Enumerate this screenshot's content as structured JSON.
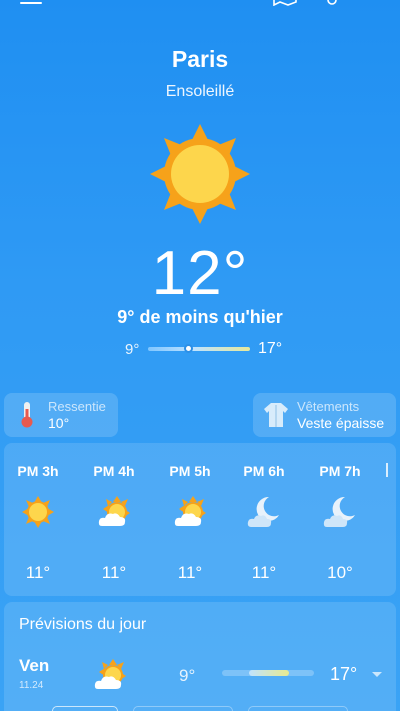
{
  "header": {
    "city": "Paris",
    "condition": "Ensoleillé",
    "temperature": "12°",
    "comparison": "9° de moins qu'hier",
    "range_low": "9°",
    "range_high": "17°",
    "range_position": 0.4
  },
  "chips": {
    "feels_like": {
      "label": "Ressentie",
      "value": "10°"
    },
    "clothing": {
      "label": "Vêtements",
      "value": "Veste épaisse"
    }
  },
  "hourly": [
    {
      "time": "PM 3h",
      "icon": "sun-icon",
      "temp": "11°"
    },
    {
      "time": "PM 4h",
      "icon": "sun-cloud-icon",
      "temp": "11°"
    },
    {
      "time": "PM 5h",
      "icon": "sun-cloud-icon",
      "temp": "11°"
    },
    {
      "time": "PM 6h",
      "icon": "moon-cloud-icon",
      "temp": "11°"
    },
    {
      "time": "PM 7h",
      "icon": "moon-cloud-icon",
      "temp": "10°"
    }
  ],
  "daily": {
    "title": "Prévisions du jour",
    "rows": [
      {
        "day": "Ven",
        "date": "11.24",
        "icon": "sun-cloud-icon",
        "low": "9°",
        "high": "17°"
      }
    ]
  },
  "colors": {
    "background": "#2f9af4",
    "sun": "#fdd64c",
    "sun_rays": "#f6a21a"
  }
}
